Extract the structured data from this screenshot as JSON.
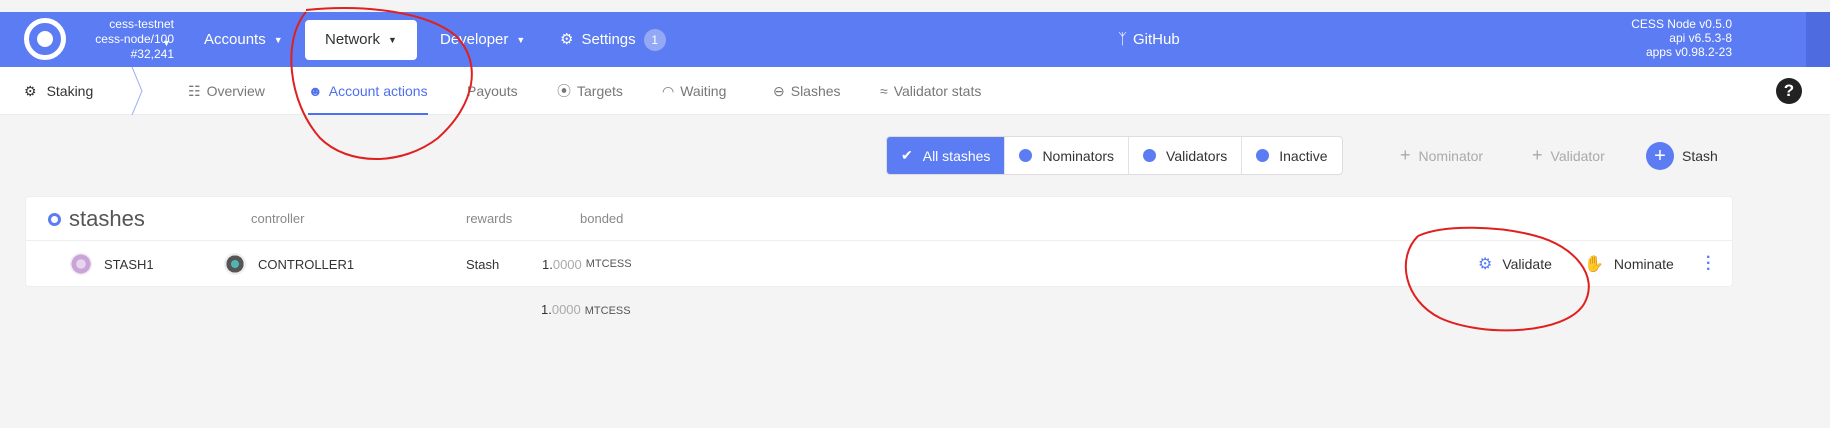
{
  "topbar": {
    "chain_name": "cess-testnet",
    "chain_node": "cess-node/100",
    "block": "#32,241",
    "nav": [
      {
        "label": "Accounts"
      },
      {
        "label": "Network"
      },
      {
        "label": "Developer"
      },
      {
        "label": "Settings",
        "badge": "1"
      }
    ],
    "github": "GitHub",
    "node_version": "CESS Node v0.5.0",
    "api_version": "api v6.5.3-8",
    "apps_version": "apps v0.98.2-23"
  },
  "subnav": {
    "root": "Staking",
    "tabs": [
      {
        "label": "Overview",
        "icon": "overview-icon"
      },
      {
        "label": "Account actions",
        "icon": "user-icon",
        "active": true
      },
      {
        "label": "Payouts",
        "icon": ""
      },
      {
        "label": "Targets",
        "icon": "target-icon"
      },
      {
        "label": "Waiting",
        "icon": "waiting-icon"
      },
      {
        "label": "Slashes",
        "icon": "minus-circle-icon"
      },
      {
        "label": "Validator stats",
        "icon": "stats-icon"
      }
    ]
  },
  "filters": {
    "all": "All stashes",
    "nominators": "Nominators",
    "validators": "Validators",
    "inactive": "Inactive"
  },
  "actions": {
    "nominator": "Nominator",
    "validator": "Validator",
    "stash": "Stash"
  },
  "table": {
    "title": "stashes",
    "columns": {
      "controller": "controller",
      "rewards": "rewards",
      "bonded": "bonded"
    },
    "row": {
      "stash": "STASH1",
      "controller": "CONTROLLER1",
      "rewards": "Stash",
      "bonded_int": "1.",
      "bonded_dec": "0000",
      "unit": "MTCESS",
      "validate": "Validate",
      "nominate": "Nominate"
    },
    "total_int": "1.",
    "total_dec": "0000",
    "total_unit": "MTCESS"
  },
  "colors": {
    "accent": "#5b7cf2",
    "annotation": "#e0201f"
  }
}
